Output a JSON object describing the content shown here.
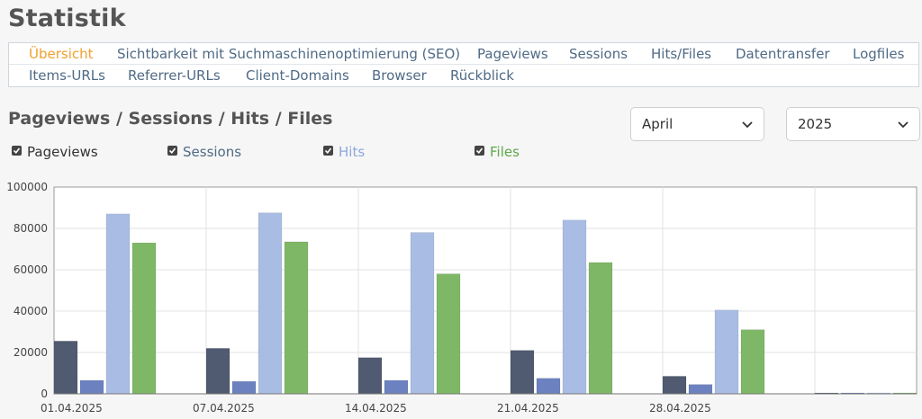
{
  "page": {
    "title": "Statistik"
  },
  "nav": {
    "row1": [
      "Übersicht",
      "Sichtbarkeit mit Suchmaschinenoptimierung (SEO)",
      "Pageviews",
      "Sessions",
      "Hits/Files",
      "Datentransfer",
      "Logfiles"
    ],
    "row2": [
      "Items-URLs",
      "Referrer-URLs",
      "Client-Domains",
      "Browser",
      "Rückblick"
    ],
    "active": "Übersicht"
  },
  "section": {
    "title": "Pageviews / Sessions / Hits / Files"
  },
  "filters": {
    "month": "April",
    "year": "2025"
  },
  "legend": [
    {
      "label": "Pageviews",
      "color": "#333333",
      "checked": true
    },
    {
      "label": "Sessions",
      "color": "#4f6a85",
      "checked": true
    },
    {
      "label": "Hits",
      "color": "#8ba8dc",
      "checked": true
    },
    {
      "label": "Files",
      "color": "#5ea84a",
      "checked": true
    }
  ],
  "chart_data": {
    "type": "bar",
    "categories": [
      "01.04.2025",
      "07.04.2025",
      "14.04.2025",
      "21.04.2025",
      "28.04.2025",
      ""
    ],
    "series": [
      {
        "name": "Pageviews",
        "color": "#505a70",
        "values": [
          25500,
          22000,
          17500,
          21000,
          8500,
          300
        ]
      },
      {
        "name": "Sessions",
        "color": "#6c82c0",
        "values": [
          6500,
          6000,
          6500,
          7500,
          4500,
          200
        ]
      },
      {
        "name": "Hits",
        "color": "#a8bce4",
        "values": [
          87000,
          87500,
          78000,
          84000,
          40500,
          300
        ]
      },
      {
        "name": "Files",
        "color": "#7eb866",
        "values": [
          73000,
          73500,
          58000,
          63500,
          31000,
          300
        ]
      }
    ],
    "y_ticks": [
      0,
      20000,
      40000,
      60000,
      80000,
      100000
    ],
    "ylim": [
      0,
      100000
    ],
    "grid": true
  }
}
